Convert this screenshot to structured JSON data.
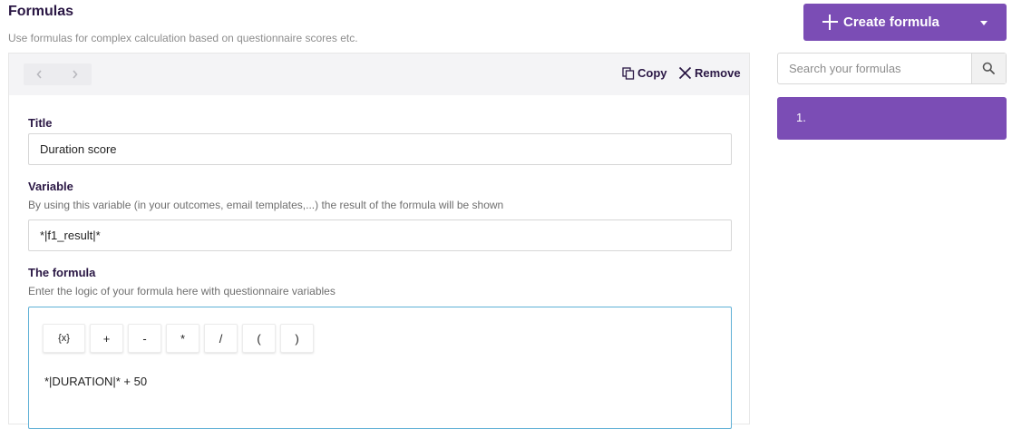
{
  "header": {
    "title": "Formulas",
    "subtitle": "Use formulas for complex calculation based on questionnaire scores etc."
  },
  "sidebar": {
    "create_label": "Create formula",
    "search_placeholder": "Search your formulas",
    "items": [
      {
        "label": "1."
      }
    ]
  },
  "toolbar": {
    "copy_label": "Copy",
    "remove_label": "Remove"
  },
  "form": {
    "title_label": "Title",
    "title_value": "Duration score",
    "variable_label": "Variable",
    "variable_help": "By using this variable (in your outcomes, email templates,...) the result of the formula will be shown",
    "variable_value": "*|f1_result|*",
    "formula_label": "The formula",
    "formula_help": "Enter the logic of your formula here with questionnaire variables",
    "operators": [
      "{x}",
      "+",
      "-",
      "*",
      "/",
      "(",
      ")"
    ],
    "formula_value": "*|DURATION|* + 50"
  },
  "colors": {
    "accent": "#7b4db5",
    "editor_border": "#5fb0d6",
    "toolbar_bg": "#f4f4f6"
  }
}
